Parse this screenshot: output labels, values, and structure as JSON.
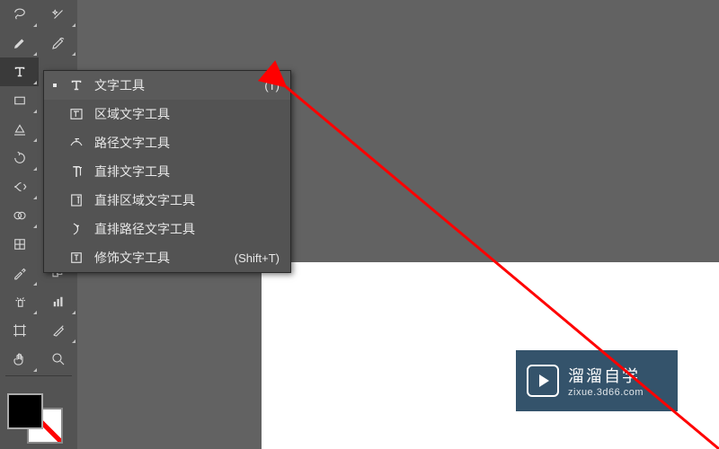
{
  "flyout": {
    "items": [
      {
        "label": "文字工具",
        "shortcut": "(T)",
        "selected": true,
        "bullet": true,
        "icon": "text"
      },
      {
        "label": "区域文字工具",
        "shortcut": "",
        "selected": false,
        "bullet": false,
        "icon": "area-text"
      },
      {
        "label": "路径文字工具",
        "shortcut": "",
        "selected": false,
        "bullet": false,
        "icon": "path-text"
      },
      {
        "label": "直排文字工具",
        "shortcut": "",
        "selected": false,
        "bullet": false,
        "icon": "vertical-text"
      },
      {
        "label": "直排区域文字工具",
        "shortcut": "",
        "selected": false,
        "bullet": false,
        "icon": "vertical-area-text"
      },
      {
        "label": "直排路径文字工具",
        "shortcut": "",
        "selected": false,
        "bullet": false,
        "icon": "vertical-path-text"
      },
      {
        "label": "修饰文字工具",
        "shortcut": "(Shift+T)",
        "selected": false,
        "bullet": false,
        "icon": "touch-text"
      }
    ]
  },
  "watermark": {
    "title": "溜溜自学",
    "sub": "zixue.3d66.com"
  },
  "colors": {
    "panel": "#535353",
    "accent": "#ff0000",
    "watermark_bg": "#34536b"
  }
}
